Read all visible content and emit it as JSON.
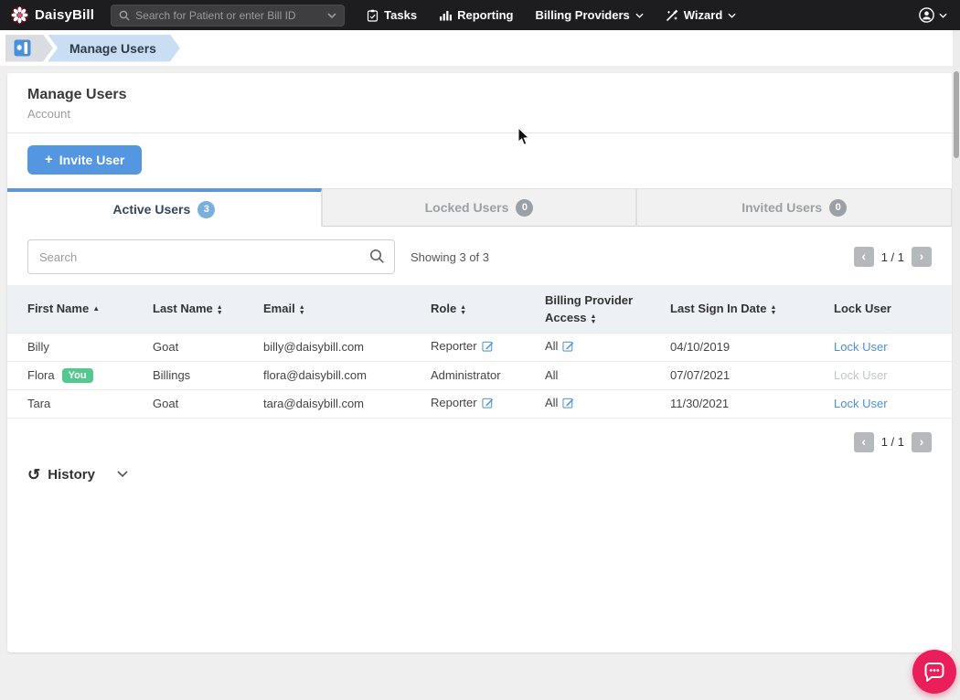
{
  "navbar": {
    "brand": "DaisyBill",
    "search_placeholder": "Search for Patient or enter Bill ID",
    "tasks": "Tasks",
    "reporting": "Reporting",
    "billing_providers": "Billing Providers",
    "wizard": "Wizard"
  },
  "breadcrumb": {
    "current": "Manage Users"
  },
  "page": {
    "title": "Manage Users",
    "subtitle": "Account"
  },
  "invite_button": {
    "plus": "+",
    "label": "Invite User"
  },
  "tabs": [
    {
      "label": "Active Users",
      "count": "3"
    },
    {
      "label": "Locked Users",
      "count": "0"
    },
    {
      "label": "Invited Users",
      "count": "0"
    }
  ],
  "toolbar": {
    "search_placeholder": "Search",
    "showing": "Showing 3 of 3",
    "page_indicator": "1 / 1"
  },
  "table": {
    "columns": [
      "First Name",
      "Last Name",
      "Email",
      "Role",
      "Billing Provider Access",
      "Last Sign In Date",
      "Lock User"
    ],
    "rows": [
      {
        "first_name": "Billy",
        "last_name": "Goat",
        "email": "billy@daisybill.com",
        "role": "Reporter",
        "access": "All",
        "last_sign_in": "04/10/2019",
        "lock": "Lock User"
      },
      {
        "first_name": "Flora",
        "you_badge": "You",
        "last_name": "Billings",
        "email": "flora@daisybill.com",
        "role": "Administrator",
        "access": "All",
        "last_sign_in": "07/07/2021",
        "lock": "Lock User"
      },
      {
        "first_name": "Tara",
        "last_name": "Goat",
        "email": "tara@daisybill.com",
        "role": "Reporter",
        "access": "All",
        "last_sign_in": "11/30/2021",
        "lock": "Lock User"
      }
    ]
  },
  "pagination": {
    "page_indicator": "1 / 1"
  },
  "history": {
    "label": "History"
  },
  "colors": {
    "navbar_bg": "#1d1d1f",
    "accent_blue": "#4a90d9",
    "button_blue": "#5596e0",
    "tab_active_border": "#5e96d5",
    "badge_green": "#53c98f",
    "chat_pink": "#ea1e59",
    "breadcrumb_blue": "#c9def2"
  }
}
